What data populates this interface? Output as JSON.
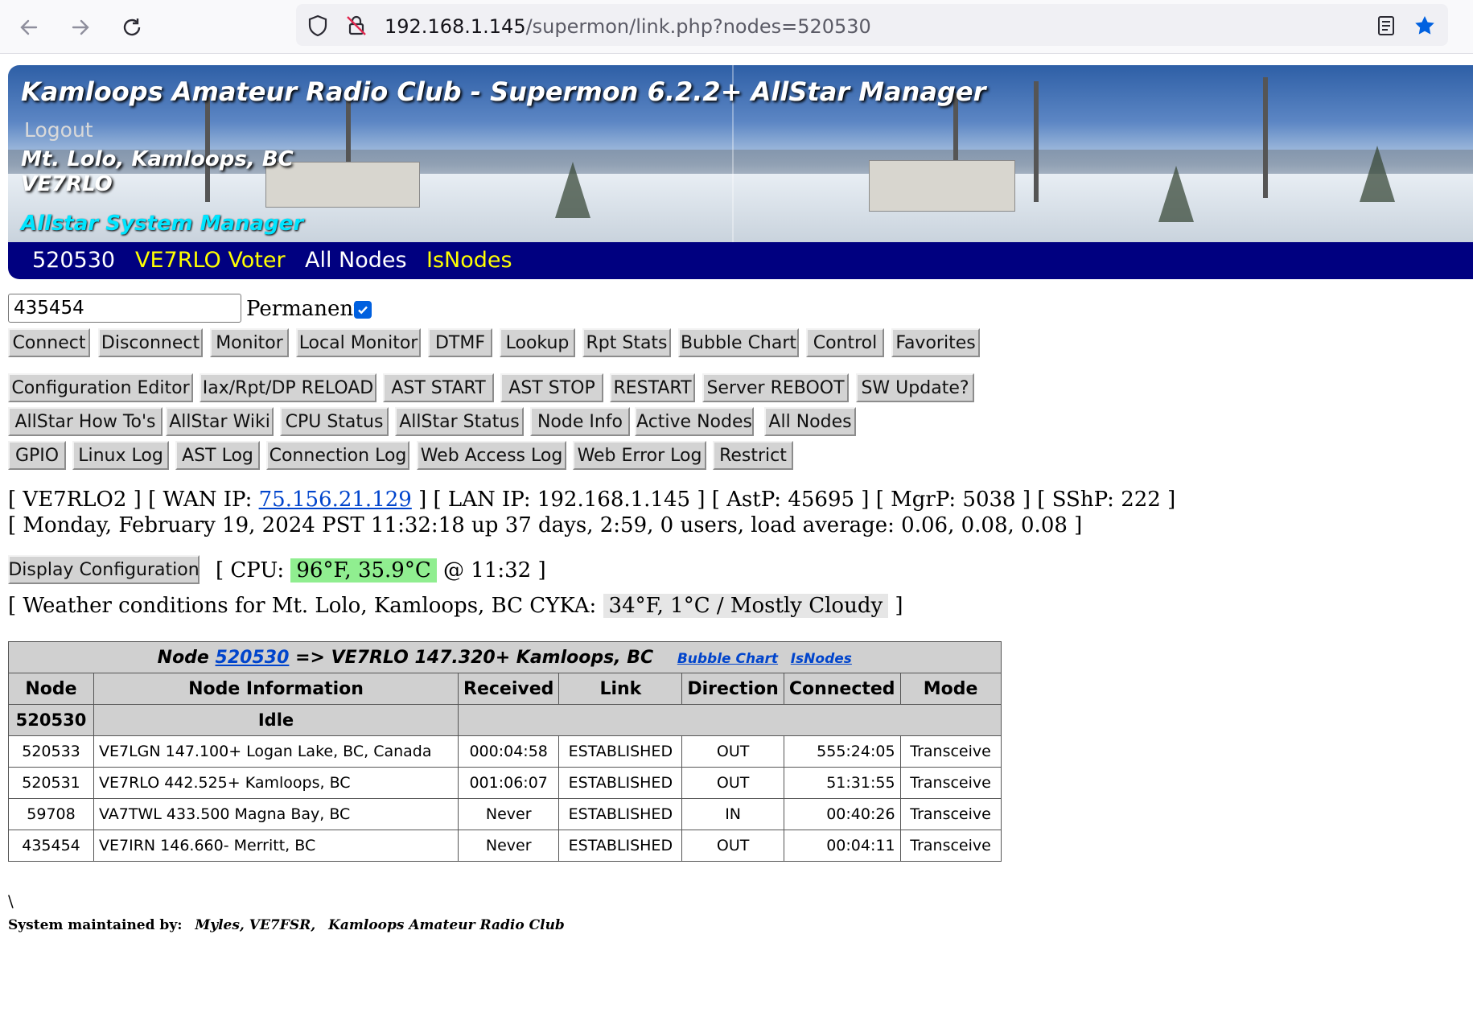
{
  "browser": {
    "url_host": "192.168.1.145",
    "url_path": "/supermon/link.php?nodes=520530"
  },
  "banner": {
    "title": "Kamloops Amateur Radio Club - Supermon 6.2.2+ AllStar Manager",
    "logout": "Logout",
    "location": "Mt. Lolo, Kamloops, BC",
    "callsign": "VE7RLO",
    "subtitle": "Allstar System Manager"
  },
  "nav": {
    "items": [
      "520530",
      "VE7RLO Voter",
      "All Nodes",
      "IsNodes"
    ],
    "colors": [
      "#ffffff",
      "#ffff00",
      "#ffffff",
      "#ffff00"
    ]
  },
  "controls": {
    "node_value": "435454",
    "permanent_label": "Permanent",
    "permanent_checked": true,
    "row1": [
      "Connect",
      "Disconnect",
      "Monitor",
      "Local Monitor",
      "DTMF",
      "Lookup",
      "Rpt Stats",
      "Bubble Chart",
      "Control",
      "Favorites"
    ],
    "row2": [
      "Configuration Editor",
      "Iax/Rpt/DP RELOAD",
      "AST START",
      "AST STOP",
      "RESTART",
      "Server REBOOT",
      "SW Update?"
    ],
    "row3": [
      "AllStar How To's",
      "AllStar Wiki",
      "CPU Status",
      "AllStar Status",
      "Node Info",
      "Active Nodes",
      "All Nodes"
    ],
    "row4": [
      "GPIO",
      "Linux Log",
      "AST Log",
      "Connection Log",
      "Web Access Log",
      "Web Error Log",
      "Restrict"
    ]
  },
  "status": {
    "host": "VE7RLO2",
    "wan_label": "WAN IP:",
    "wan_ip": "75.156.21.129",
    "lan": "LAN IP: 192.168.1.145",
    "astp": "AstP: 45695",
    "mgrp": "MgrP: 5038",
    "sshp": "SShP: 222",
    "uptime": "[ Monday, February 19, 2024 PST 11:32:18 up 37 days, 2:59, 0 users, load average: 0.06, 0.08, 0.08 ]",
    "display_config": "Display Configuration",
    "cpu_label": "[ CPU:",
    "cpu_temp": "96°F, 35.9°C",
    "cpu_time": "@ 11:32 ]",
    "weather_label": "[ Weather conditions for Mt. Lolo, Kamloops, BC CYKA:",
    "weather_value": "34°F, 1°C / Mostly Cloudy",
    "weather_end": "]"
  },
  "node_table": {
    "caption_prefix": "Node",
    "node": "520530",
    "caption_suffix": "=> VE7RLO 147.320+ Kamloops, BC",
    "bubble_link": "Bubble Chart",
    "isnodes_link": "IsNodes",
    "headers": [
      "Node",
      "Node Information",
      "Received",
      "Link",
      "Direction",
      "Connected",
      "Mode"
    ],
    "self_row": {
      "node": "520530",
      "info": "Idle"
    },
    "rows": [
      [
        "520533",
        "VE7LGN 147.100+ Logan Lake, BC, Canada",
        "000:04:58",
        "ESTABLISHED",
        "OUT",
        "555:24:05",
        "Transceive"
      ],
      [
        "520531",
        "VE7RLO 442.525+ Kamloops, BC",
        "001:06:07",
        "ESTABLISHED",
        "OUT",
        "51:31:55",
        "Transceive"
      ],
      [
        "59708",
        "VA7TWL 433.500 Magna Bay, BC",
        "Never",
        "ESTABLISHED",
        "IN",
        "00:40:26",
        "Transceive"
      ],
      [
        "435454",
        "VE7IRN 146.660- Merritt, BC",
        "Never",
        "ESTABLISHED",
        "OUT",
        "00:04:11",
        "Transceive"
      ]
    ]
  },
  "footer": {
    "backslash": "\\",
    "maintained_label": "System maintained by:",
    "maintainer": "Myles, VE7FSR,",
    "club": "Kamloops Amateur Radio Club"
  }
}
